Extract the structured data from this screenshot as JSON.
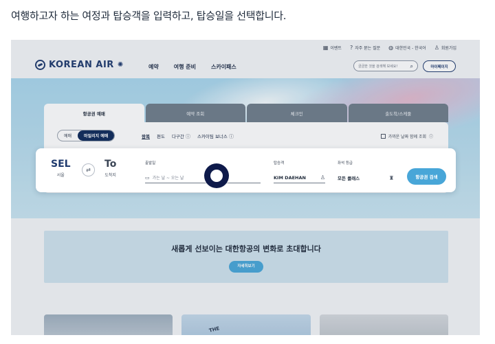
{
  "instruction": "여행하고자 하는 여정과 탑승객을 입력하고, 탑승일을 선택합니다.",
  "utility_bar": [
    {
      "icon": "calendar-icon",
      "label": "이벤트"
    },
    {
      "icon": "question-icon",
      "label": "자주 묻는 질문"
    },
    {
      "icon": "globe-icon",
      "label": "대한민국 - 한국어"
    },
    {
      "icon": "user-plus-icon",
      "label": "회원가입"
    }
  ],
  "header": {
    "logo_text": "KOREAN AIR",
    "nav": [
      "예약",
      "여행 준비",
      "스카이패스"
    ],
    "search_placeholder": "궁금한 것을 검색해 보세요!",
    "mypage_label": "마이페이지"
  },
  "booking_tabs": [
    "항공권 예매",
    "예약 조회",
    "체크인",
    "출도착/스케줄"
  ],
  "booking_mode": {
    "options": [
      "예매",
      "마일리지 예매"
    ],
    "selected": "마일리지 예매"
  },
  "trip_types": [
    {
      "label": "왕복",
      "selected": true
    },
    {
      "label": "편도",
      "selected": false
    },
    {
      "label": "다구간",
      "selected": false,
      "help": true
    },
    {
      "label": "스카이팀 보너스",
      "selected": false,
      "help": true
    }
  ],
  "nearby_dates_label": "가까운 날짜 함께 조회",
  "route": {
    "from_code": "SEL",
    "from_city": "서울",
    "to_code": "To",
    "to_city": "도착지"
  },
  "fields": {
    "date_label": "출발일",
    "date_placeholder": "가는 날 ~ 오는 날",
    "pax_label": "탑승객",
    "pax_value": "KIM DAEHAN",
    "cabin_label": "좌석 등급",
    "cabin_value": "모든 클래스",
    "search_button": "항공권 검색"
  },
  "promo": {
    "title": "새롭게 선보이는 대한항공의 변화로 초대합니다",
    "button": "자세히보기"
  },
  "card_caption": "THE"
}
